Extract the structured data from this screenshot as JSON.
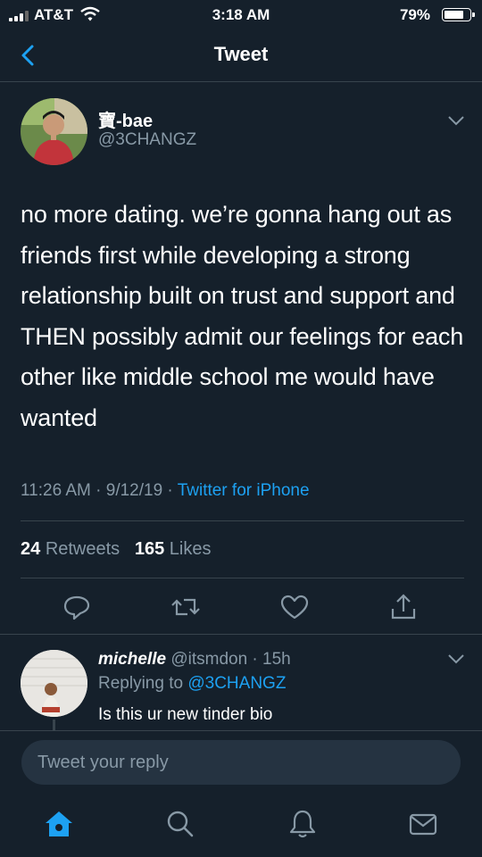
{
  "status_bar": {
    "carrier": "AT&T",
    "time": "3:18 AM",
    "battery_pct": "79%",
    "battery_level": 0.79
  },
  "nav": {
    "title": "Tweet",
    "back_icon": "chevron-left-icon"
  },
  "tweet": {
    "author_name": "寶-bae",
    "author_handle": "@3CHANGZ",
    "text": "no more dating. we’re gonna hang out as friends first while developing a strong relationship built on trust and support and THEN possibly admit our feelings for each other like middle school me would have wanted",
    "timestamp": "11:26 AM · 9/12/19 · ",
    "source": "Twitter for iPhone",
    "retweets_count": "24",
    "retweets_label": "Retweets",
    "likes_count": "165",
    "likes_label": "Likes",
    "actions": [
      "reply-icon",
      "retweet-icon",
      "like-icon",
      "share-icon"
    ]
  },
  "reply": {
    "name": "michelle",
    "handle_time": " @itsmdon · 15h",
    "replying_to_label": "Replying to ",
    "replying_to_handle": "@3CHANGZ",
    "text": "Is this ur new tinder bio"
  },
  "compose": {
    "placeholder": "Tweet your reply"
  },
  "tab_bar": [
    "home-icon",
    "search-icon",
    "notifications-icon",
    "messages-icon"
  ],
  "colors": {
    "background": "#15202b",
    "accent": "#1da1f2",
    "muted": "#8899a6",
    "divider": "#38444d"
  }
}
